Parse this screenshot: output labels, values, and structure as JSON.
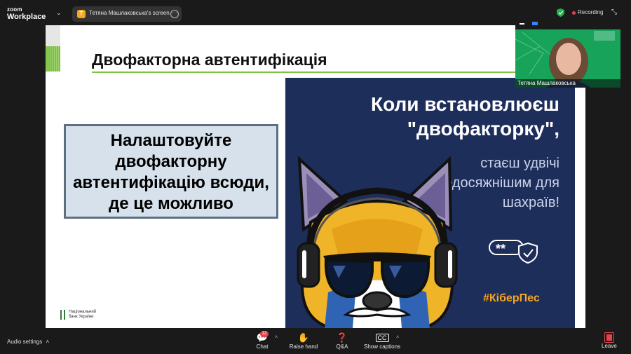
{
  "app": {
    "logo_line1": "zoom",
    "logo_line2": "Workplace"
  },
  "share": {
    "badge": "T",
    "label": "Тетяна Машлаковська's screen"
  },
  "status": {
    "recording": "Recording",
    "accent_color": "#e0454f"
  },
  "slide": {
    "title": "Двофакторна автентифікація",
    "callout": "Налаштовуйте двофакторну автентифікацію всюди, де це можливо",
    "nbu_logo_text": "Національний\nбанк України",
    "poster": {
      "headline_1": "Коли встановлюєш",
      "headline_2": "\"двофакторку\",",
      "subtext": "стаєш удвічі недосяжнішим для шахраїв!",
      "password_mask": "**",
      "hashtag": "#КіберПес"
    }
  },
  "self_view": {
    "name": "Тетяна Машлаковська"
  },
  "toolbar": {
    "audio_settings": "Audio settings",
    "chat": {
      "label": "Chat",
      "badge": "12"
    },
    "raise_hand": "Raise hand",
    "qa": "Q&A",
    "captions": "Show captions",
    "leave": "Leave"
  }
}
